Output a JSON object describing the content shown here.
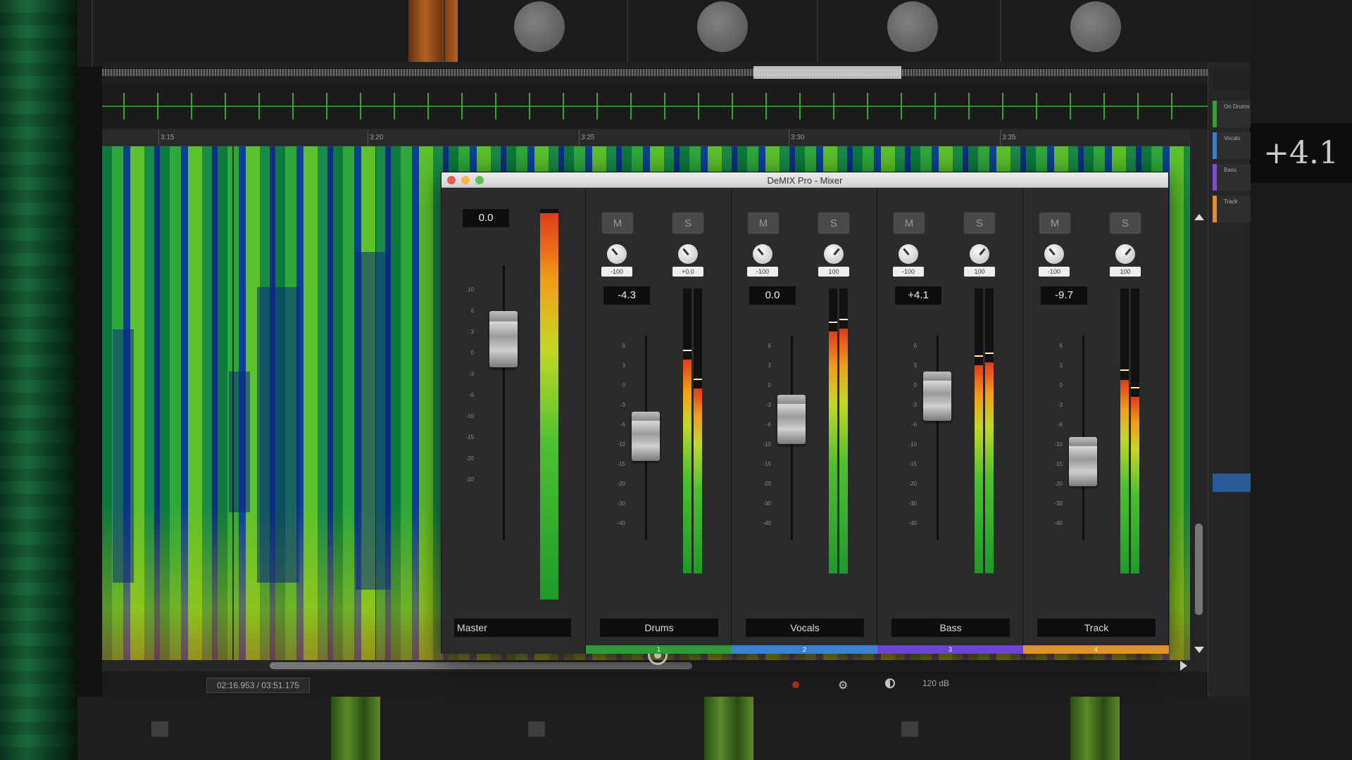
{
  "background_readout": "+4.1",
  "editor": {
    "ruler_ticks": [
      "3:15",
      "3:20",
      "3:25",
      "3:30",
      "3:35"
    ],
    "time_display": "02:16.953 / 03:51.175",
    "db_range": "120 dB",
    "side_items": [
      {
        "label": "On Drums",
        "color": "#3a9a3a"
      },
      {
        "label": "Vocals",
        "color": "#3a7ad8"
      },
      {
        "label": "Bass",
        "color": "#7a4ad8"
      },
      {
        "label": "Track",
        "color": "#e0902a"
      }
    ]
  },
  "mixer": {
    "title": "DeMIX Pro - Mixer",
    "master": {
      "gain": "0.0",
      "name": "Master",
      "meter_level": 0.99
    },
    "channels": [
      {
        "name": "Drums",
        "gain": "-4.3",
        "mute": "M",
        "solo": "S",
        "knob1": "-100",
        "knob2": "+0.0",
        "number": "1",
        "color": "#2f9a3a",
        "fader": 0.54,
        "meter": [
          0.75,
          0.65
        ],
        "has_settings": true
      },
      {
        "name": "Vocals",
        "gain": "0.0",
        "mute": "M",
        "solo": "S",
        "knob1": "-100",
        "knob2": "100",
        "number": "2",
        "color": "#3a82d8",
        "fader": 0.62,
        "meter": [
          0.85,
          0.86
        ],
        "has_settings": false
      },
      {
        "name": "Bass",
        "gain": "+4.1",
        "mute": "M",
        "solo": "S",
        "knob1": "-100",
        "knob2": "100",
        "number": "3",
        "color": "#6a44d8",
        "fader": 0.73,
        "meter": [
          0.73,
          0.74
        ],
        "has_settings": false
      },
      {
        "name": "Track",
        "gain": "-9.7",
        "mute": "M",
        "solo": "S",
        "knob1": "-100",
        "knob2": "100",
        "number": "4",
        "color": "#e0912a",
        "fader": 0.42,
        "meter": [
          0.68,
          0.62
        ],
        "has_settings": false
      }
    ],
    "fader_scale": [
      "6",
      "3",
      "0",
      "-3",
      "-6",
      "-10",
      "-15",
      "-20",
      "-30",
      "-40"
    ],
    "master_scale": [
      "10",
      "6",
      "3",
      "0",
      "-3",
      "-6",
      "-10",
      "-15",
      "-20",
      "-30"
    ]
  }
}
